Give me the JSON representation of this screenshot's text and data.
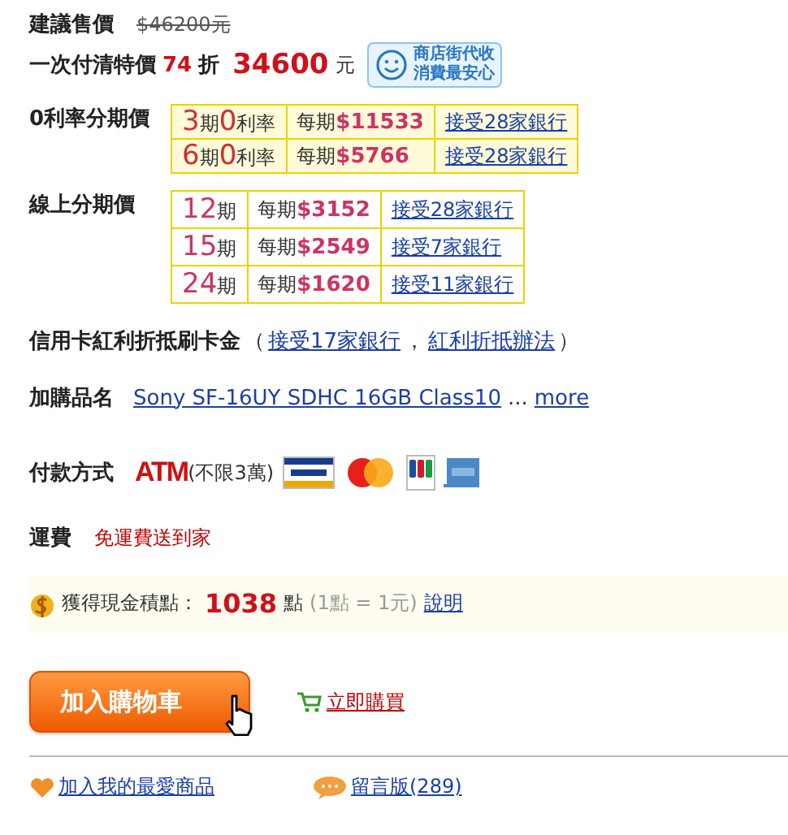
{
  "list_price": {
    "label": "建議售價",
    "value": "$46200元"
  },
  "special_price": {
    "label": "一次付清特價",
    "discount": "74",
    "discount_unit": "折",
    "price": "34600",
    "unit": "元",
    "badge_lines": [
      "商店街代收",
      "消費最安心"
    ]
  },
  "zero_rate": {
    "label": "0利率分期價",
    "rows": [
      {
        "periods": "3",
        "period_unit": "期",
        "rate": "0",
        "rate_unit": "利率",
        "per_label": "每期",
        "amount": "$11533",
        "link": "接受28家銀行"
      },
      {
        "periods": "6",
        "period_unit": "期",
        "rate": "0",
        "rate_unit": "利率",
        "per_label": "每期",
        "amount": "$5766",
        "link": "接受28家銀行"
      }
    ]
  },
  "online": {
    "label": "線上分期價",
    "rows": [
      {
        "periods": "12",
        "period_unit": "期",
        "per_label": "每期",
        "amount": "$3152",
        "link": "接受28家銀行"
      },
      {
        "periods": "15",
        "period_unit": "期",
        "per_label": "每期",
        "amount": "$2549",
        "link": "接受7家銀行"
      },
      {
        "periods": "24",
        "period_unit": "期",
        "per_label": "每期",
        "amount": "$1620",
        "link": "接受11家銀行"
      }
    ]
  },
  "credit": {
    "label": "信用卡紅利折抵刷卡金",
    "open": "（",
    "banks_link": "接受17家銀行",
    "separator": "，",
    "rules_link": "紅利折抵辦法",
    "close": "）"
  },
  "addon": {
    "label": "加購品名",
    "product_link": "Sony SF-16UY SDHC 16GB Class10",
    "ellipsis": "...",
    "more_link": "more"
  },
  "payment": {
    "label": "付款方式",
    "atm": "ATM",
    "atm_note": "(不限3萬)"
  },
  "shipping": {
    "label": "運費",
    "value": "免運費送到家"
  },
  "points": {
    "label": "獲得現金積點：",
    "value": "1038",
    "unit": "點",
    "note": "(1點 = 1元)",
    "link": "說明"
  },
  "actions": {
    "cart_button": "加入購物車",
    "buy_link": "立即購買"
  },
  "footer": {
    "favorite_link": "加入我的最愛商品",
    "board_link": "留言版(289)"
  }
}
